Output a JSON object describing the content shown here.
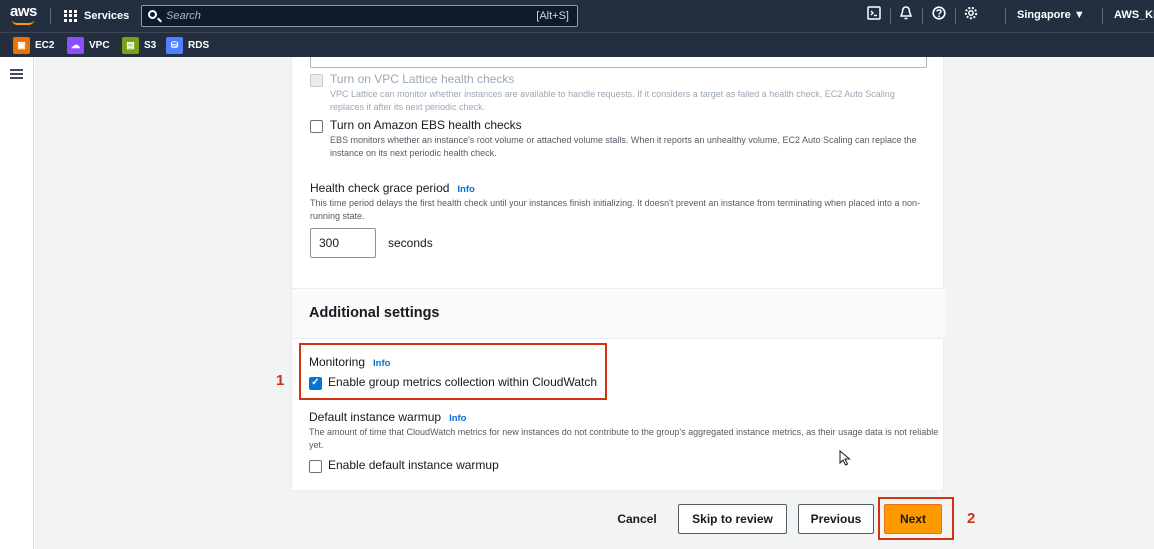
{
  "topnav": {
    "logo": "aws",
    "services_label": "Services",
    "search_placeholder": "Search",
    "search_shortcut": "[Alt+S]",
    "region": "Singapore ▼",
    "account": "AWS_KH"
  },
  "favorites": [
    {
      "label": "EC2",
      "color": "#ed7100",
      "icon": "ec2-icon"
    },
    {
      "label": "VPC",
      "color": "#8c4fff",
      "icon": "vpc-icon"
    },
    {
      "label": "S3",
      "color": "#7aa116",
      "icon": "s3-icon"
    },
    {
      "label": "RDS",
      "color": "#527fff",
      "icon": "rds-icon"
    }
  ],
  "health_checks": {
    "vpc_lattice_label": "Turn on VPC Lattice health checks",
    "vpc_lattice_desc": "VPC Lattice can monitor whether instances are available to handle requests. If it considers a target as failed a health check, EC2 Auto Scaling replaces it after its next periodic check.",
    "ebs_label": "Turn on Amazon EBS health checks",
    "ebs_desc": "EBS monitors whether an instance's root volume or attached volume stalls. When it reports an unhealthy volume, EC2 Auto Scaling can replace the instance on its next periodic health check.",
    "grace_label": "Health check grace period",
    "grace_info": "Info",
    "grace_desc": "This time period delays the first health check until your instances finish initializing. It doesn't prevent an instance from terminating when placed into a non-running state.",
    "grace_value": "300",
    "grace_unit": "seconds"
  },
  "additional": {
    "title": "Additional settings",
    "monitoring_label": "Monitoring",
    "monitoring_info": "Info",
    "metrics_label": "Enable group metrics collection within CloudWatch",
    "metrics_checked": true,
    "warmup_label": "Default instance warmup",
    "warmup_info": "Info",
    "warmup_desc": "The amount of time that CloudWatch metrics for new instances do not contribute to the group's aggregated instance metrics, as their usage data is not reliable yet.",
    "warmup_checkbox_label": "Enable default instance warmup",
    "warmup_checked": false
  },
  "footer": {
    "cancel": "Cancel",
    "skip": "Skip to review",
    "previous": "Previous",
    "next": "Next"
  },
  "annotations": {
    "step1": "1",
    "step2": "2",
    "color": "#d13212"
  }
}
